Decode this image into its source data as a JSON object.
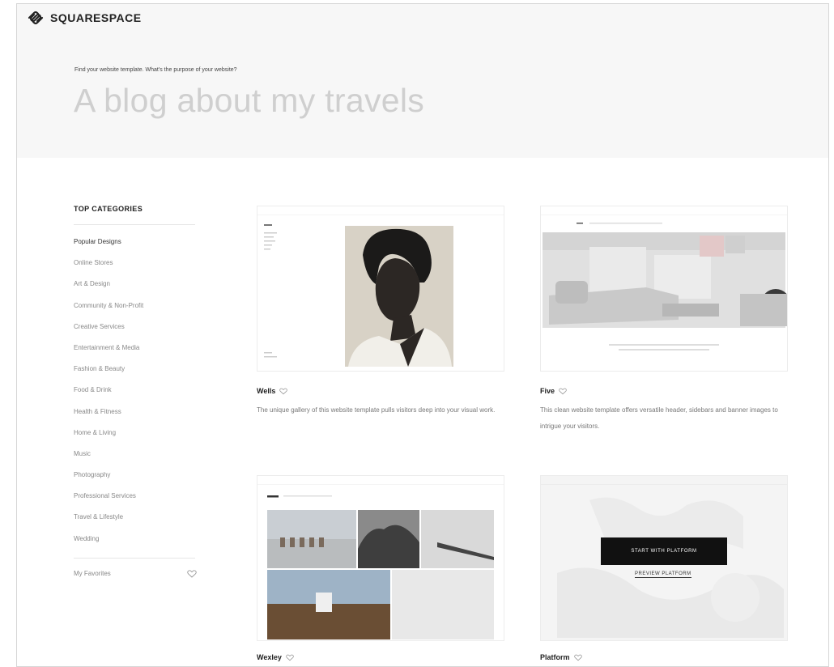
{
  "brand": {
    "name": "SQUARESPACE"
  },
  "hero": {
    "prompt": "Find your website template. What's the purpose of your website?",
    "title": "A blog about my travels"
  },
  "sidebar": {
    "heading": "TOP CATEGORIES",
    "categories": [
      "Popular Designs",
      "Online Stores",
      "Art & Design",
      "Community & Non-Profit",
      "Creative Services",
      "Entertainment & Media",
      "Fashion & Beauty",
      "Food & Drink",
      "Health & Fitness",
      "Home & Living",
      "Music",
      "Photography",
      "Professional Services",
      "Travel & Lifestyle",
      "Wedding"
    ],
    "active_category": "Popular Designs",
    "favorites_label": "My Favorites"
  },
  "templates": [
    {
      "name": "Wells",
      "description": "The unique gallery of this website template pulls visitors deep into your visual work."
    },
    {
      "name": "Five",
      "description": "This clean website template offers versatile header, sidebars and banner images to intrigue your visitors."
    },
    {
      "name": "Wexley",
      "description": ""
    },
    {
      "name": "Platform",
      "description": "",
      "start_label": "START WITH PLATFORM",
      "preview_label": "PREVIEW PLATFORM"
    }
  ],
  "colors": {
    "hero_bg": "#f7f7f7",
    "title": "#cfcfcf",
    "button": "#111111"
  }
}
